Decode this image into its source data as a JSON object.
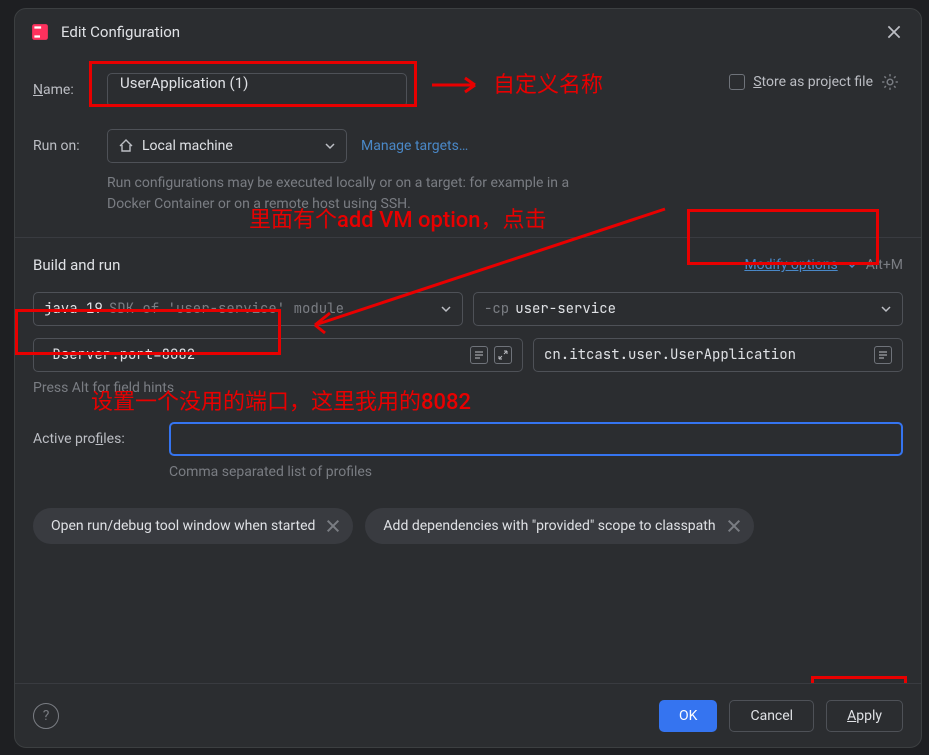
{
  "dialog": {
    "title": "Edit Configuration"
  },
  "name": {
    "label_pre": "N",
    "label_rest": "ame:",
    "value": "UserApplication (1)"
  },
  "store": {
    "label_pre": "S",
    "label_rest": "tore as project file"
  },
  "runon": {
    "label": "Run on:",
    "value": "Local machine",
    "manage": "Manage targets…",
    "hint": "Run configurations may be executed locally or on a target: for example in a Docker Container or on a remote host using SSH."
  },
  "build": {
    "title": "Build and run",
    "modify_pre": "M",
    "modify_rest": "odify options",
    "shortcut": "Alt+M"
  },
  "jdk": {
    "name": "java 19",
    "desc": "SDK of 'user-service' module"
  },
  "cp": {
    "prefix": "-cp",
    "value": "user-service"
  },
  "vm": {
    "value": "-Dserver.port=8082",
    "hint": "Press Alt for field hints"
  },
  "mainclass": {
    "value": "cn.itcast.user.UserApplication"
  },
  "profiles": {
    "label_pre": "Active pro",
    "label_underline": "f",
    "label_rest": "iles:",
    "hint": "Comma separated list of profiles"
  },
  "chips": {
    "open_tool": "Open run/debug tool window when started",
    "provided": "Add dependencies with \"provided\" scope to classpath"
  },
  "footer": {
    "ok": "OK",
    "cancel": "Cancel",
    "apply_pre": "A",
    "apply_rest": "pply"
  },
  "annotations": {
    "custom_name": "自定义名称",
    "add_vm": "里面有个add VM option，点击",
    "port_hint": "设置一个没用的端口，这里我用的8082"
  }
}
